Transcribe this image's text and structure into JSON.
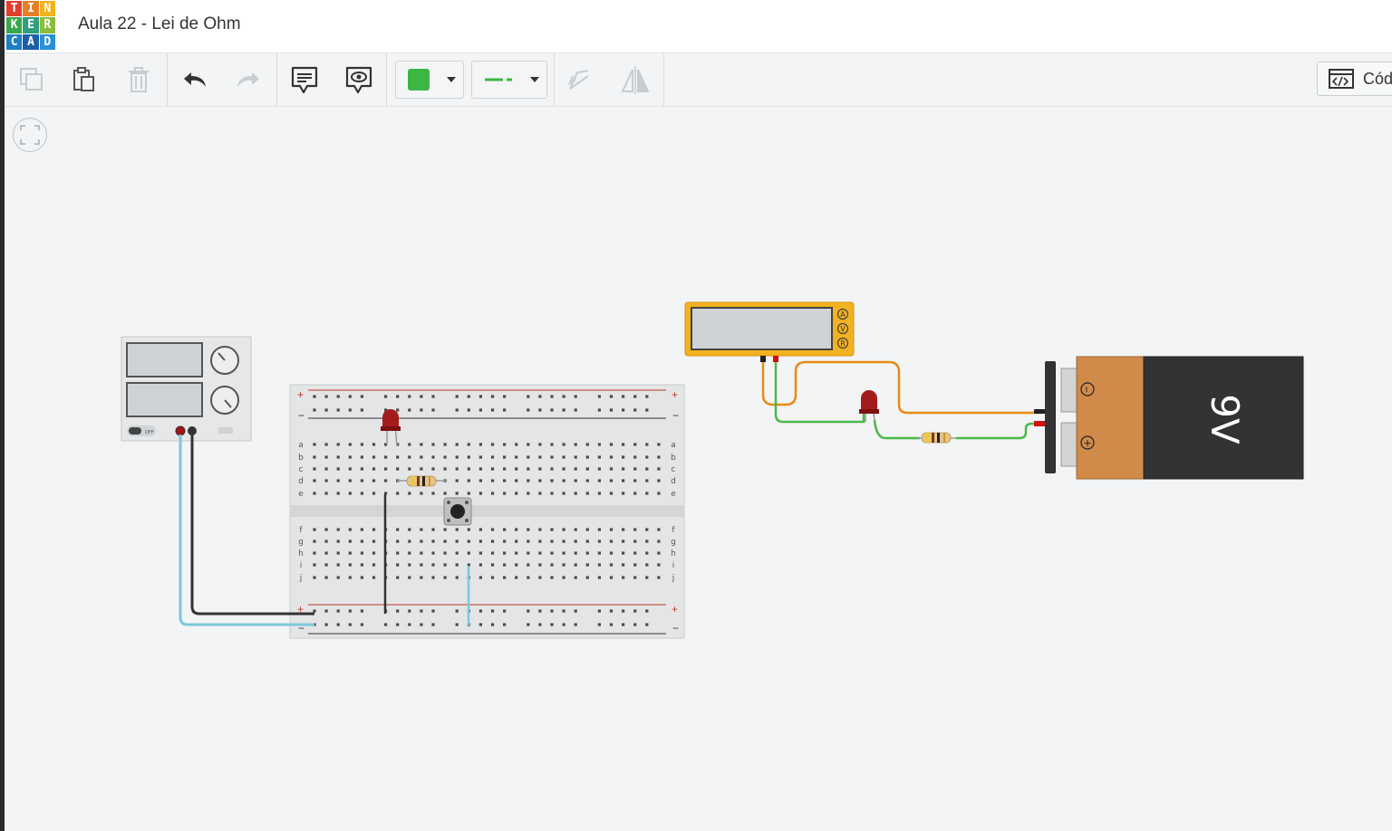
{
  "logo": {
    "letters": [
      "T",
      "I",
      "N",
      "K",
      "E",
      "R",
      "C",
      "A",
      "D"
    ],
    "colors": [
      "#e2402f",
      "#e77f26",
      "#f3b21b",
      "#3aa64b",
      "#2f9f7e",
      "#8bbd3c",
      "#1e7fc2",
      "#1b5fa8",
      "#2a8fd6"
    ]
  },
  "title": "Aula 22 - Lei de Ohm",
  "toolbar": {
    "copy_icon": "copy-icon",
    "paste_icon": "paste-icon",
    "delete_icon": "trash-icon",
    "undo_icon": "undo-icon",
    "redo_icon": "redo-icon",
    "notes_icon": "notes-icon",
    "view_icon": "eye-icon",
    "color_swatch": "#3cb744",
    "wire_color": "#3cb744",
    "rotate_icon": "rotate-icon",
    "mirror_icon": "mirror-icon",
    "code_label": "Cód"
  },
  "canvas": {
    "battery_label": "9V",
    "battery_minus": "−",
    "battery_plus": "+",
    "multimeter_modes": [
      "A",
      "V",
      "R"
    ],
    "power_supply_switch": "OFF",
    "breadboard_top_rows": [
      "a",
      "b",
      "c",
      "d",
      "e"
    ],
    "breadboard_bottom_rows": [
      "f",
      "g",
      "h",
      "i",
      "j"
    ],
    "rail_plus": "+",
    "rail_minus": "−"
  }
}
